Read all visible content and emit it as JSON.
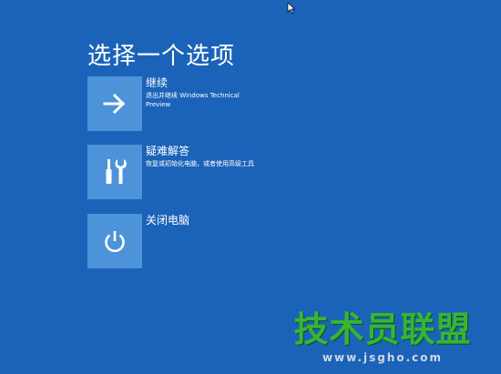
{
  "page": {
    "title": "选择一个选项"
  },
  "options": [
    {
      "label": "继续",
      "description": "退出并继续 Windows Technical Preview",
      "icon": "arrow-right-icon"
    },
    {
      "label": "疑难解答",
      "description": "恢复或初始化电脑，或者使用高级工具",
      "icon": "tools-icon"
    },
    {
      "label": "关闭电脑",
      "description": "",
      "icon": "power-icon"
    }
  ],
  "watermark": {
    "text": "技术员联盟",
    "url": "www.jsgho.com"
  },
  "colors": {
    "background": "#1b63b8",
    "tile": "#4c93d9",
    "watermark_green": "#37b437"
  }
}
